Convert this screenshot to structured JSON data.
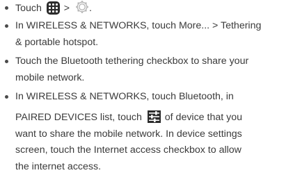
{
  "steps": [
    {
      "a_prefix": "Touch",
      "a_sep": ">",
      "a_end": "."
    },
    {
      "a": "In WIRELESS & NETWORKS, touch More... > Tethering",
      "b": "& portable hotspot."
    },
    {
      "a": "Touch the Bluetooth tethering checkbox to share your",
      "b": "mobile network."
    },
    {
      "a": "In WIRELESS & NETWORKS, touch Bluetooth, in",
      "b_prefix": "PAIRED DEVICES list, touch",
      "b_suffix": "of device that you",
      "c": "want to share the mobile network. In device settings",
      "d": "screen, touch the Internet access checkbox to allow",
      "e": "the internet access."
    }
  ],
  "icons": {
    "apps": "apps-grid-icon",
    "settings": "settings-gear-icon",
    "device_settings": "device-settings-sliders-icon"
  }
}
